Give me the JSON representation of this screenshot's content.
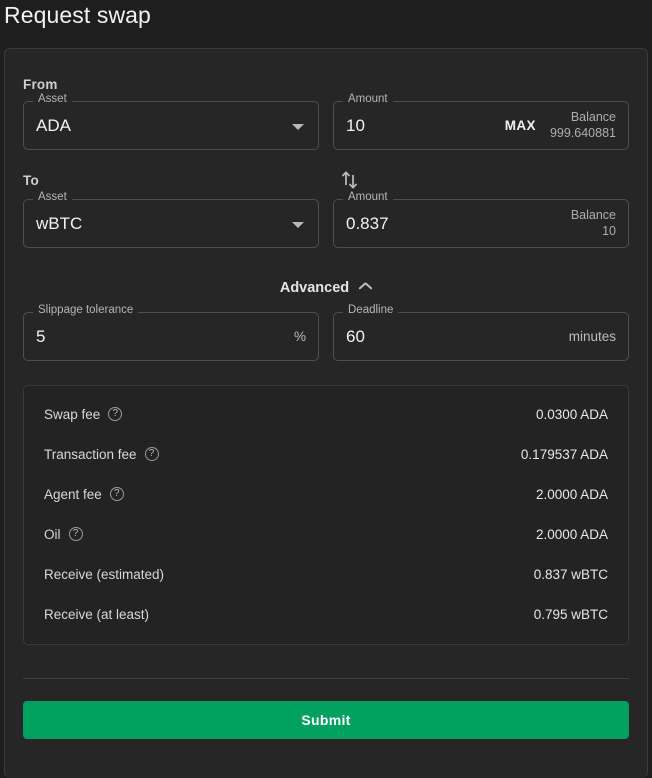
{
  "page": {
    "title": "Request swap"
  },
  "from": {
    "section_label": "From",
    "asset": {
      "legend": "Asset",
      "value": "ADA",
      "caret_icon": "chevron-down-icon"
    },
    "amount": {
      "legend": "Amount",
      "value": "10",
      "max_label": "MAX",
      "balance_label": "Balance",
      "balance_value": "999.640881"
    }
  },
  "swap_direction": {
    "icon": "swap-vertical-icon"
  },
  "to": {
    "section_label": "To",
    "asset": {
      "legend": "Asset",
      "value": "wBTC",
      "caret_icon": "chevron-down-icon"
    },
    "amount": {
      "legend": "Amount",
      "value": "0.837",
      "balance_label": "Balance",
      "balance_value": "10"
    }
  },
  "advanced": {
    "label": "Advanced",
    "chevron_icon": "chevron-up-icon",
    "expanded": true,
    "slippage": {
      "legend": "Slippage tolerance",
      "value": "5",
      "suffix": "%"
    },
    "deadline": {
      "legend": "Deadline",
      "value": "60",
      "suffix": "minutes"
    }
  },
  "fees": {
    "help_icon": "help-circle-icon",
    "rows": [
      {
        "label": "Swap fee",
        "value": "0.0300 ADA",
        "help": true
      },
      {
        "label": "Transaction fee",
        "value": "0.179537 ADA",
        "help": true
      },
      {
        "label": "Agent fee",
        "value": "2.0000 ADA",
        "help": true
      },
      {
        "label": "Oil",
        "value": "2.0000 ADA",
        "help": true
      },
      {
        "label": "Receive (estimated)",
        "value": "0.837 wBTC",
        "help": false
      },
      {
        "label": "Receive (at least)",
        "value": "0.795 wBTC",
        "help": false
      }
    ]
  },
  "actions": {
    "submit_label": "Submit"
  },
  "colors": {
    "accent_green": "#00a05e",
    "page_background": "#1e1e1e",
    "card_background": "#262626",
    "fee_panel_background": "#232323",
    "border": "#4e4e4e",
    "text_primary": "#f2f2f2",
    "text_secondary": "#adadad"
  }
}
